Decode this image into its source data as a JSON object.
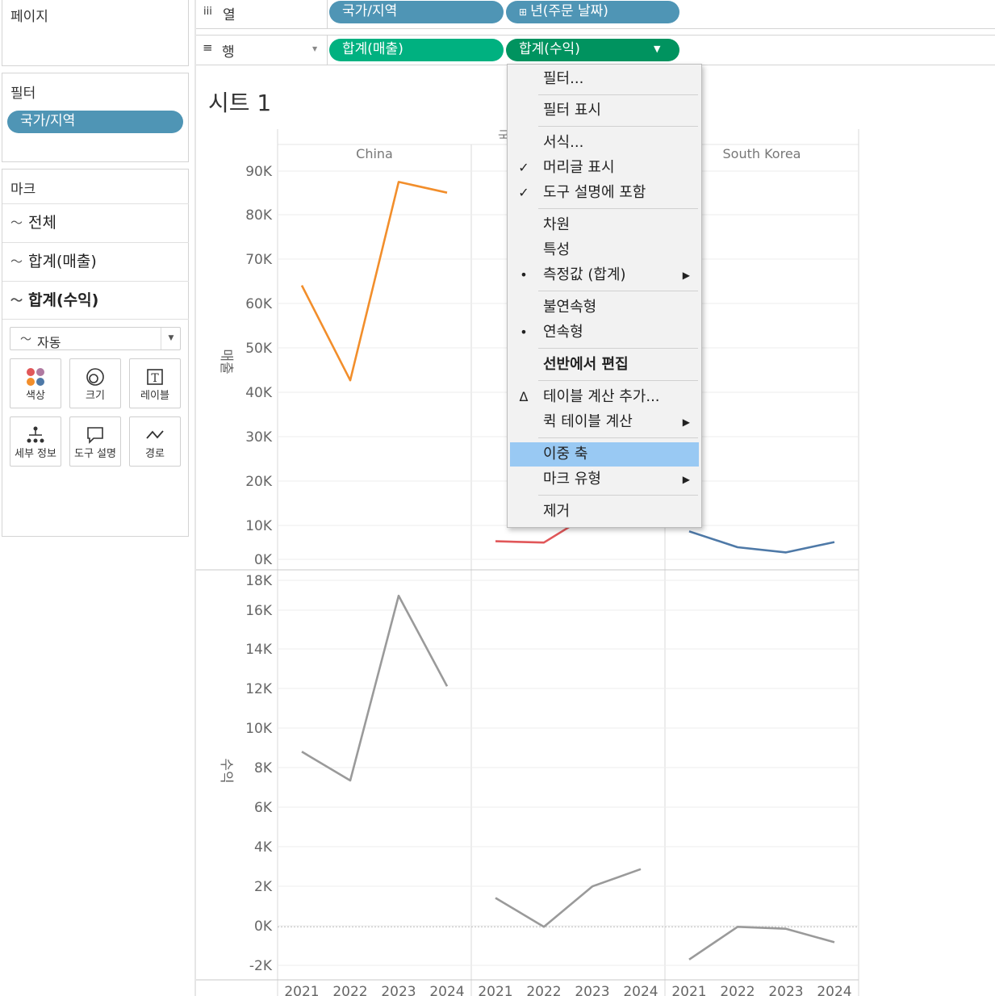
{
  "left_pane": {
    "pages": {
      "title": "페이지"
    },
    "filters": {
      "title": "필터",
      "pills": [
        "국가/지역"
      ]
    },
    "marks": {
      "title": "마크",
      "rows": [
        {
          "label": "전체",
          "bold": false
        },
        {
          "label": "합계(매출)",
          "bold": false
        },
        {
          "label": "합계(수익)",
          "bold": true
        }
      ],
      "mark_type": "자동",
      "cards": [
        {
          "label": "색상",
          "icon": "color-dots-icon"
        },
        {
          "label": "크기",
          "icon": "size-icon"
        },
        {
          "label": "레이블",
          "icon": "label-icon"
        },
        {
          "label": "세부 정보",
          "icon": "detail-icon"
        },
        {
          "label": "도구 설명",
          "icon": "tooltip-icon"
        },
        {
          "label": "경로",
          "icon": "path-icon"
        }
      ]
    }
  },
  "shelves": {
    "columns": {
      "label": "열",
      "icon": "iii",
      "pills": [
        "국가/지역",
        "년(주문 날짜)"
      ],
      "pill2_prefix": "⊞"
    },
    "rows": {
      "label": "행",
      "icon": "≡",
      "pills": [
        "합계(매출)",
        "합계(수익)"
      ]
    }
  },
  "sheet": {
    "title": "시트 1"
  },
  "context_menu": {
    "items": [
      {
        "label": "필터...",
        "mark": ""
      },
      {
        "label": "필터 표시",
        "mark": ""
      },
      {
        "label": "서식...",
        "mark": ""
      },
      {
        "label": "머리글 표시",
        "mark": "✓"
      },
      {
        "label": "도구 설명에 포함",
        "mark": "✓"
      },
      {
        "label": "차원",
        "mark": ""
      },
      {
        "label": "특성",
        "mark": ""
      },
      {
        "label": "측정값 (합계)",
        "mark": "•",
        "submenu": true
      },
      {
        "label": "불연속형",
        "mark": ""
      },
      {
        "label": "연속형",
        "mark": "•"
      },
      {
        "label": "선반에서 편집",
        "mark": "",
        "bold": true
      },
      {
        "label": "테이블 계산 추가...",
        "mark": "Δ"
      },
      {
        "label": "퀵 테이블 계산",
        "mark": "",
        "submenu": true
      },
      {
        "label": "이중 축",
        "mark": "",
        "highlighted": true
      },
      {
        "label": "마크 유형",
        "mark": "",
        "submenu": true
      },
      {
        "label": "제거",
        "mark": ""
      }
    ]
  },
  "chart_data": {
    "type": "line",
    "column_header_partial": "국",
    "panes": [
      "China",
      "",
      "South Korea"
    ],
    "x": [
      "2021",
      "2022",
      "2023",
      "2024"
    ],
    "rows": [
      {
        "ylabel": "매출",
        "ylim": [
          0,
          90000
        ],
        "ticks": [
          "90K",
          "80K",
          "70K",
          "60K",
          "50K",
          "40K",
          "30K",
          "20K",
          "10K",
          "0K"
        ],
        "series": [
          {
            "pane": 0,
            "values": [
              63500,
              41500,
              87500,
              85000
            ],
            "color": "#f28e2b"
          },
          {
            "pane": 1,
            "values": [
              4200,
              3900,
              10800,
              9800
            ],
            "color": "#e15759",
            "visible_from": 1
          },
          {
            "pane": 2,
            "values": [
              6500,
              2800,
              1600,
              4000
            ],
            "color": "#4e79a7"
          }
        ]
      },
      {
        "ylabel": "수익",
        "ylim": [
          -2000,
          18000
        ],
        "ticks": [
          "18K",
          "16K",
          "14K",
          "12K",
          "10K",
          "8K",
          "6K",
          "4K",
          "2K",
          "0K",
          "-2K"
        ],
        "series": [
          {
            "pane": 0,
            "values": [
              9100,
              7600,
              17200,
              12500
            ],
            "color": "#9a9a9a"
          },
          {
            "pane": 1,
            "values": [
              1500,
              0,
              2100,
              3000
            ],
            "color": "#9a9a9a"
          },
          {
            "pane": 2,
            "values": [
              -1700,
              0,
              -100,
              -800
            ],
            "color": "#9a9a9a"
          }
        ]
      }
    ]
  }
}
